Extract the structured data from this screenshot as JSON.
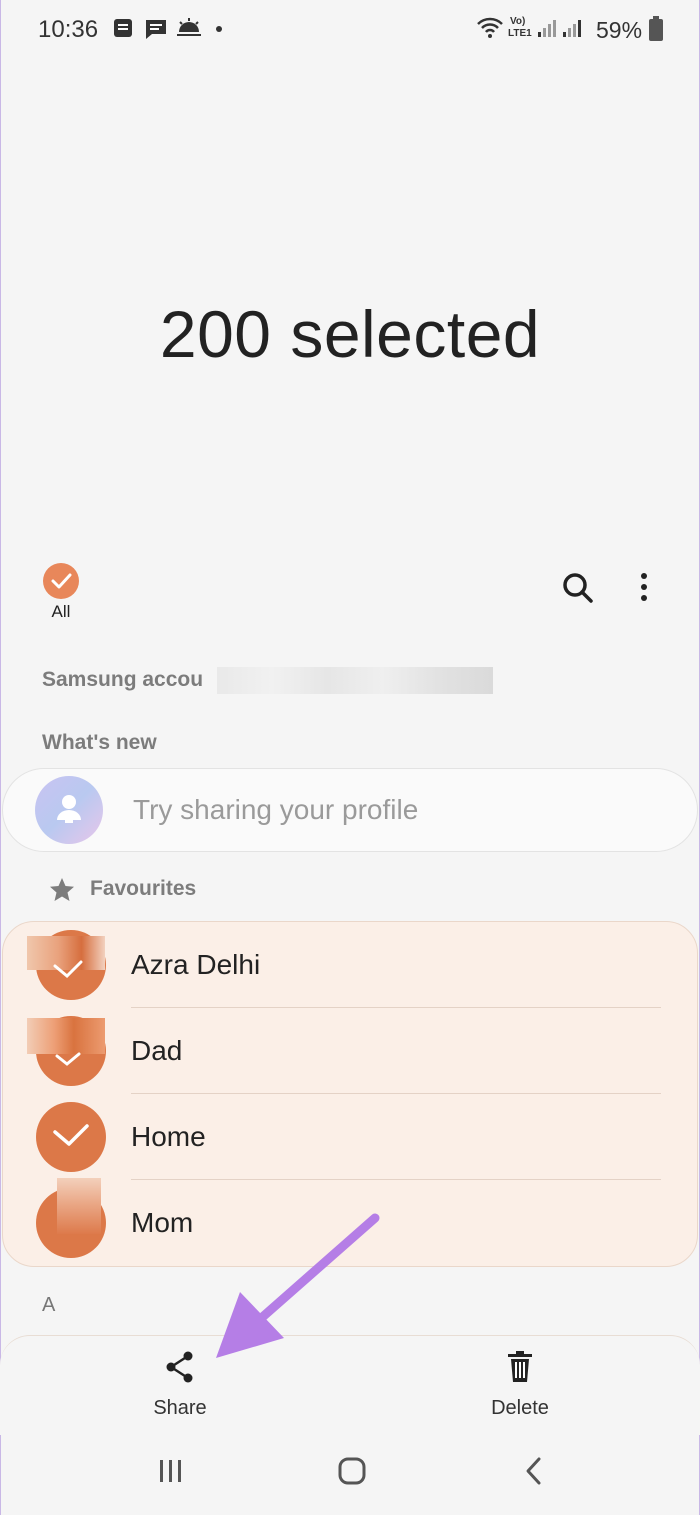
{
  "status_bar": {
    "time": "10:36",
    "battery": "59%",
    "icons": [
      "notification-icon",
      "message-icon",
      "weather-icon",
      "dot-icon",
      "wifi-icon",
      "volte-icon",
      "signal-icon",
      "battery-icon"
    ]
  },
  "header": {
    "title": "200 selected"
  },
  "toolbar": {
    "select_all_label": "All",
    "icons": [
      "search-icon",
      "more-icon"
    ]
  },
  "account": {
    "label": "Samsung accou"
  },
  "whats_new": {
    "label": "What's new",
    "profile_prompt": "Try sharing your profile"
  },
  "favourites": {
    "label": "Favourites",
    "contacts": [
      {
        "name": "Azra Delhi"
      },
      {
        "name": "Dad"
      },
      {
        "name": "Home"
      },
      {
        "name": "Mom"
      }
    ]
  },
  "index": {
    "letter": "A"
  },
  "actions": {
    "share_label": "Share",
    "delete_label": "Delete"
  },
  "navigation": {
    "buttons": [
      "recents-button",
      "home-button",
      "back-button"
    ]
  },
  "colors": {
    "accent": "#e8875a",
    "avatar": "#dc7848",
    "highlight_arrow": "#b57ee6"
  }
}
